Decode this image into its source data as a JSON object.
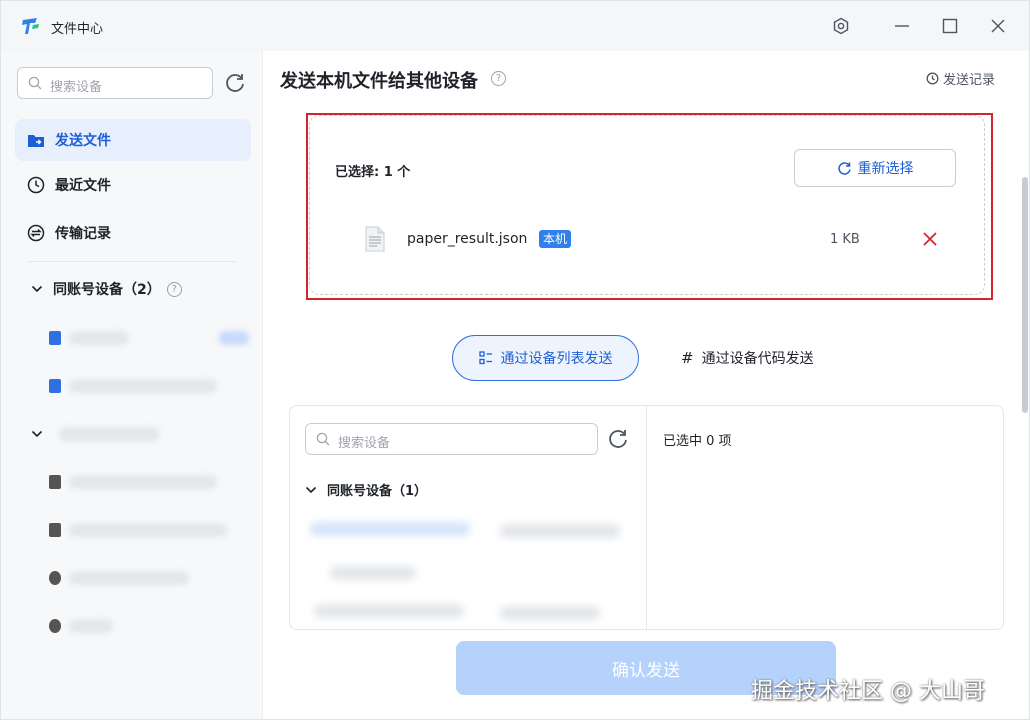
{
  "window": {
    "title": "文件中心",
    "controls": [
      "settings-icon",
      "minimize-icon",
      "maximize-icon",
      "close-icon"
    ]
  },
  "sidebar": {
    "search_placeholder": "搜索设备",
    "nav": [
      {
        "label": "发送文件",
        "icon": "send-folder-icon",
        "active": true
      },
      {
        "label": "最近文件",
        "icon": "clock-icon",
        "active": false
      },
      {
        "label": "传输记录",
        "icon": "transfer-icon",
        "active": false
      }
    ],
    "group": {
      "label": "同账号设备（2）"
    }
  },
  "main": {
    "title": "发送本机文件给其他设备",
    "send_records": "发送记录",
    "selection": {
      "label": "已选择: 1 个",
      "reselect": "重新选择",
      "files": [
        {
          "name": "paper_result.json",
          "badge": "本机",
          "size": "1 KB"
        }
      ]
    },
    "modes": [
      {
        "label": "通过设备列表发送",
        "active": true
      },
      {
        "label": "通过设备代码发送",
        "active": false
      }
    ],
    "device_panel": {
      "search_placeholder": "搜索设备",
      "group_label": "同账号设备（1）",
      "selected_count": "已选中 0 项"
    },
    "confirm": "确认发送"
  },
  "watermark": "掘金技术社区 @ 大山哥",
  "colors": {
    "accent": "#1e5fd6",
    "active_bg": "#e7effd",
    "highlight_frame": "#d4252f",
    "confirm_disabled": "#b4d2fb"
  }
}
